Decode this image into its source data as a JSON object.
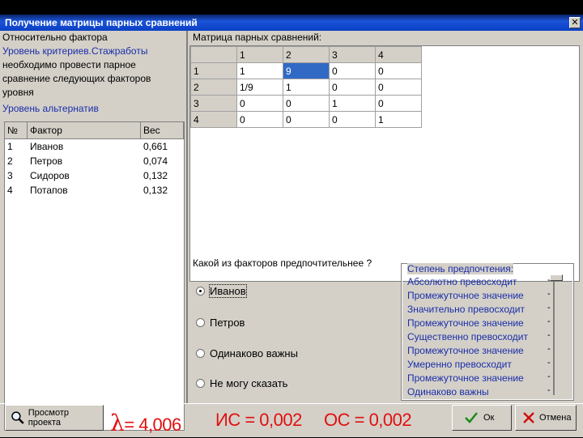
{
  "window": {
    "title": "Получение матрицы парных сравнений",
    "close_glyph": "✕"
  },
  "left_panel": {
    "relative_label": "Относительно фактора",
    "criteria_level": "Уровень критериев.Стажработы",
    "instruction": [
      "необходимо провести парное",
      "сравнение следующих факторов",
      "уровня"
    ],
    "alternatives_level": "Уровень альтернатив",
    "columns": [
      "№",
      "Фактор",
      "Вес"
    ],
    "rows": [
      {
        "n": "1",
        "factor": "Иванов",
        "weight": "0,661"
      },
      {
        "n": "2",
        "factor": "Петров",
        "weight": "0,074"
      },
      {
        "n": "3",
        "factor": "Сидоров",
        "weight": "0,132"
      },
      {
        "n": "4",
        "factor": "Потапов",
        "weight": "0,132"
      }
    ]
  },
  "matrix": {
    "label": "Матрица парных сравнений:",
    "col_headers": [
      "1",
      "2",
      "3",
      "4"
    ],
    "rows": [
      {
        "h": "1",
        "cells": [
          "1",
          "9",
          "0",
          "0"
        ]
      },
      {
        "h": "2",
        "cells": [
          "1/9",
          "1",
          "0",
          "0"
        ]
      },
      {
        "h": "3",
        "cells": [
          "0",
          "0",
          "1",
          "0"
        ]
      },
      {
        "h": "4",
        "cells": [
          "0",
          "0",
          "0",
          "1"
        ]
      }
    ]
  },
  "question": {
    "label": "Какой из факторов предпочтительнее ?",
    "options": [
      "Иванов",
      "Петров",
      "Одинаково важны",
      "Не могу сказать"
    ],
    "selected_index": 0
  },
  "preference": {
    "title": "Степень предпочтения:",
    "items": [
      "Абсолютно превосходит",
      "Промежуточное значение",
      "Значительно превосходит",
      "Промежуточное значение",
      "Существенно превосходит",
      "Промежуточное значение",
      "Умеренно превосходит",
      "Промежуточное значение",
      "Одинаково важны"
    ],
    "dash": "-",
    "selected_level": 9
  },
  "bottom": {
    "view_project_label": "Просмотр проекта",
    "lambda_symbol": "λ",
    "lambda_value": "= 4,006",
    "ic_label": "ИС = 0,002",
    "oc_label": "ОС = 0,002",
    "ok_label": "Ок",
    "cancel_label": "Отмена"
  },
  "colors": {
    "titlebar": "#0a3fc4",
    "accent_blue": "#1a2ea8",
    "metric_red": "#e01010",
    "selection": "#316ac5"
  }
}
